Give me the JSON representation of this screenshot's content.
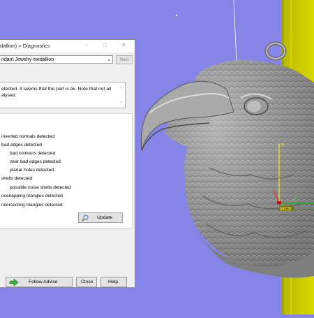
{
  "dialog": {
    "title": "dallion) > Diagnostics",
    "minimize_icon": "minimize-icon",
    "maximize_icon": "maximize-icon",
    "close_icon": "close-icon",
    "part_select": {
      "value": "ndant Jewelry medallion"
    },
    "next_label": "Next",
    "message": {
      "line1": "etected. It seems that the part is ok. Note that not all",
      "line2": "alysed."
    },
    "results": [
      "inverted normals detected",
      "bad edges detected",
      "bad contours detected",
      "near bad edges detected",
      "planar holes detected",
      "shells detected",
      "possible noise shells detected",
      "overlapping triangles detected",
      "intersecting triangles detected"
    ],
    "update_label": "Update",
    "follow_advice_label": "Follow Advice",
    "close_label": "Close",
    "help_label": "Help"
  },
  "viewport": {
    "axis_labels": {
      "y": "Y",
      "x": "X"
    },
    "wcs_label": "WCS",
    "background_color": "#8585e8",
    "platform_color": "#cccc00"
  }
}
